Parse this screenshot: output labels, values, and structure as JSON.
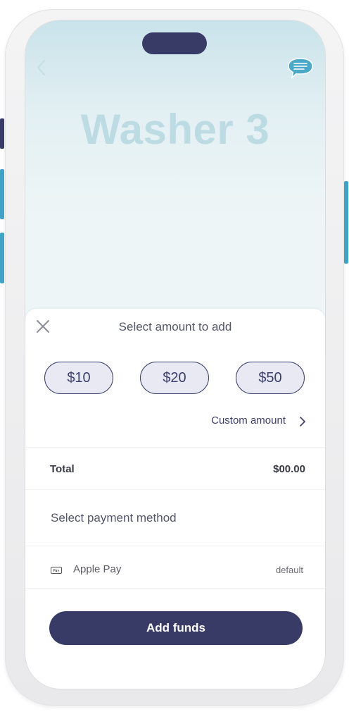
{
  "header": {
    "title": "Washer 3",
    "back_icon": "chevron-left-icon",
    "chat_icon": "chat-bubble-icon"
  },
  "sheet": {
    "title": "Select amount to add",
    "close_icon": "close-icon",
    "amounts": [
      "$10",
      "$20",
      "$50"
    ],
    "custom_amount_label": "Custom amount",
    "total_label": "Total",
    "total_value": "$00.00",
    "payment_title": "Select payment method",
    "payment_method": {
      "label": "Apple Pay",
      "icon": "apple-pay-icon",
      "icon_text": "Pay",
      "status": "default"
    },
    "add_funds_label": "Add funds"
  },
  "colors": {
    "accent": "#383b66",
    "title_tint": "#bcdbe3",
    "chip_fill": "#e9e9f4",
    "side_button_blue": "#3fa3c3"
  }
}
